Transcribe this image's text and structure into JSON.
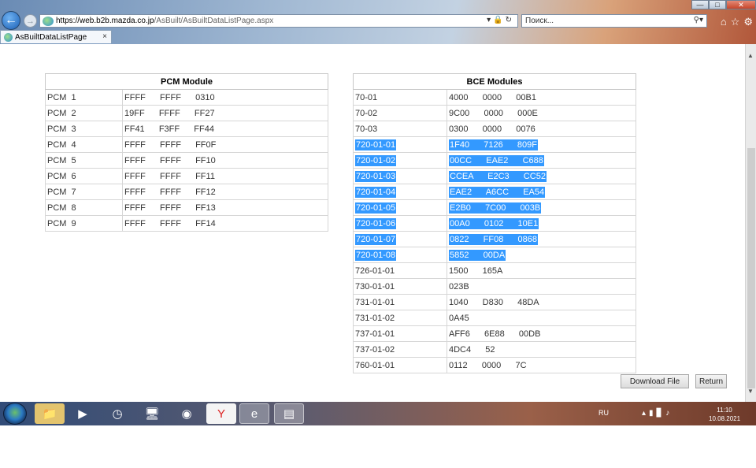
{
  "browser": {
    "url_host": "https://web.b2b.mazda.co.jp",
    "url_path": "/AsBuilt/AsBuiltDataListPage.aspx",
    "search_placeholder": "Поиск...",
    "tab_title": "AsBuiltDataListPage",
    "tab_close": "×",
    "back_icon": "arrow-left-icon",
    "forward_icon": "arrow-right-icon"
  },
  "pcm": {
    "title": "PCM Module",
    "rows": [
      {
        "name": "PCM 1",
        "value": "FFFF   FFFF   0310"
      },
      {
        "name": "PCM 2",
        "value": "19FF   FFFF   FF27"
      },
      {
        "name": "PCM 3",
        "value": "FF41   F3FF   FF44"
      },
      {
        "name": "PCM 4",
        "value": "FFFF   FFFF   FF0F"
      },
      {
        "name": "PCM 5",
        "value": "FFFF   FFFF   FF10"
      },
      {
        "name": "PCM 6",
        "value": "FFFF   FFFF   FF11"
      },
      {
        "name": "PCM 7",
        "value": "FFFF   FFFF   FF12"
      },
      {
        "name": "PCM 8",
        "value": "FFFF   FFFF   FF13"
      },
      {
        "name": "PCM 9",
        "value": "FFFF   FFFF   FF14"
      }
    ]
  },
  "bce": {
    "title": "BCE Modules",
    "rows": [
      {
        "name": "70-01",
        "value": "4000   0000   00B1",
        "selected": false
      },
      {
        "name": "70-02",
        "value": "9C00   0000   000E",
        "selected": false
      },
      {
        "name": "70-03",
        "value": "0300   0000   0076",
        "selected": false
      },
      {
        "name": "720-01-01",
        "value": "1F40   7126   809F",
        "selected": true
      },
      {
        "name": "720-01-02",
        "value": "00CC   EAE2   C688",
        "selected": true
      },
      {
        "name": "720-01-03",
        "value": "CCEA   E2C3   CC52",
        "selected": true
      },
      {
        "name": "720-01-04",
        "value": "EAE2   A6CC   EA54",
        "selected": true
      },
      {
        "name": "720-01-05",
        "value": "E2B0   7C00   003B",
        "selected": true
      },
      {
        "name": "720-01-06",
        "value": "00A0   0102   10E1",
        "selected": true
      },
      {
        "name": "720-01-07",
        "value": "0822   FF08   0868",
        "selected": true
      },
      {
        "name": "720-01-08",
        "value": "5852   00DA",
        "selected": true
      },
      {
        "name": "726-01-01",
        "value": "1500   165A",
        "selected": false
      },
      {
        "name": "730-01-01",
        "value": "023B",
        "selected": false
      },
      {
        "name": "731-01-01",
        "value": "1040   D830   48DA",
        "selected": false
      },
      {
        "name": "731-01-02",
        "value": "0A45",
        "selected": false
      },
      {
        "name": "737-01-01",
        "value": "AFF6   6E88   00DB",
        "selected": false
      },
      {
        "name": "737-01-02",
        "value": "4DC4   52",
        "selected": false
      },
      {
        "name": "760-01-01",
        "value": "0112   0000   7C",
        "selected": false
      }
    ]
  },
  "buttons": {
    "download": "Download File",
    "return": "Return"
  },
  "taskbar": {
    "lang": "RU",
    "time": "11:10",
    "date": "10.08.2021"
  },
  "colors": {
    "selection": "#3399ff"
  }
}
